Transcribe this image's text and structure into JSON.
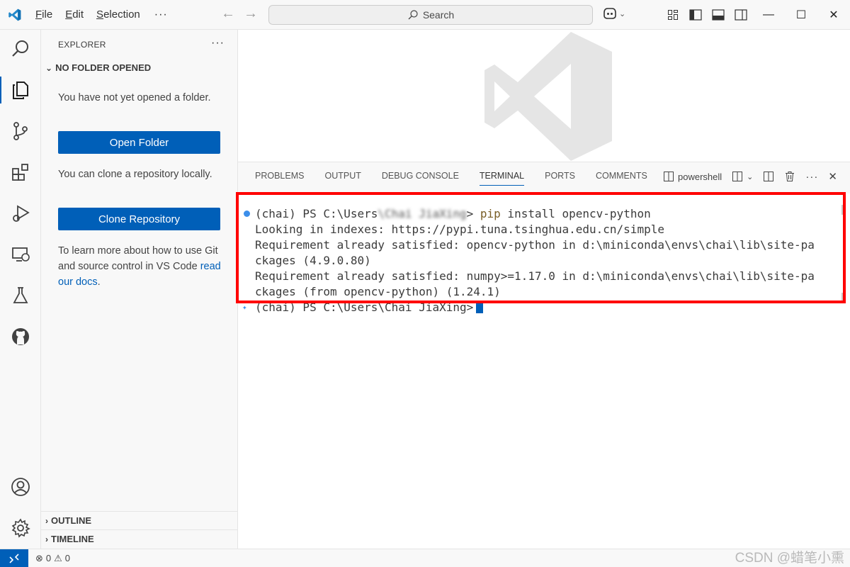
{
  "titlebar": {
    "menu": [
      {
        "label": "File",
        "key": "F",
        "rest": "ile"
      },
      {
        "label": "Edit",
        "key": "E",
        "rest": "dit"
      },
      {
        "label": "Selection",
        "key": "S",
        "rest": "election"
      }
    ],
    "more": "···",
    "search_label": "Search",
    "window_controls": [
      "minimize",
      "maximize",
      "close"
    ]
  },
  "activity_bar": [
    "explorer-icon",
    "search-icon",
    "source-control-icon",
    "extensions-icon",
    "run-debug-icon",
    "remote-explorer-icon",
    "testing-icon",
    "github-icon",
    "account-icon",
    "settings-icon"
  ],
  "sidebar": {
    "title": "EXPLORER",
    "more": "···",
    "section": "NO FOLDER OPENED",
    "text1": "You have not yet opened a folder.",
    "open_folder": "Open Folder",
    "text2": "You can clone a repository locally.",
    "clone_repo": "Clone Repository",
    "text3": "To learn more about how to use Git and source control in VS Code ",
    "docs_link": "read our docs",
    "text3_end": ".",
    "outline": "OUTLINE",
    "timeline": "TIMELINE"
  },
  "panel": {
    "tabs": [
      "PROBLEMS",
      "OUTPUT",
      "DEBUG CONSOLE",
      "TERMINAL",
      "PORTS",
      "COMMENTS"
    ],
    "active_tab": "TERMINAL",
    "shell": "powershell"
  },
  "terminal": {
    "prompt_prefix": "(chai) PS C:\\Users",
    "prompt_blurred": "\\Chai JiaXing",
    "prompt_suffix": "> ",
    "command_pip": "pip",
    "command_rest": " install opencv-python",
    "lines": [
      "Looking in indexes: https://pypi.tuna.tsinghua.edu.cn/simple",
      "Requirement already satisfied: opencv-python in d:\\miniconda\\envs\\chai\\lib\\site-pa",
      "ckages (4.9.0.80)",
      "Requirement already satisfied: numpy>=1.17.0 in d:\\miniconda\\envs\\chai\\lib\\site-pa",
      "ckages (from opencv-python) (1.24.1)"
    ],
    "prompt2": "(chai) PS C:\\Users\\Chai JiaXing>"
  },
  "statusbar": {
    "errors": "0",
    "warnings": "0",
    "watermark": "CSDN @蜡笔小熏"
  },
  "colors": {
    "accent": "#005fb8",
    "highlight_border": "#ff0000"
  }
}
